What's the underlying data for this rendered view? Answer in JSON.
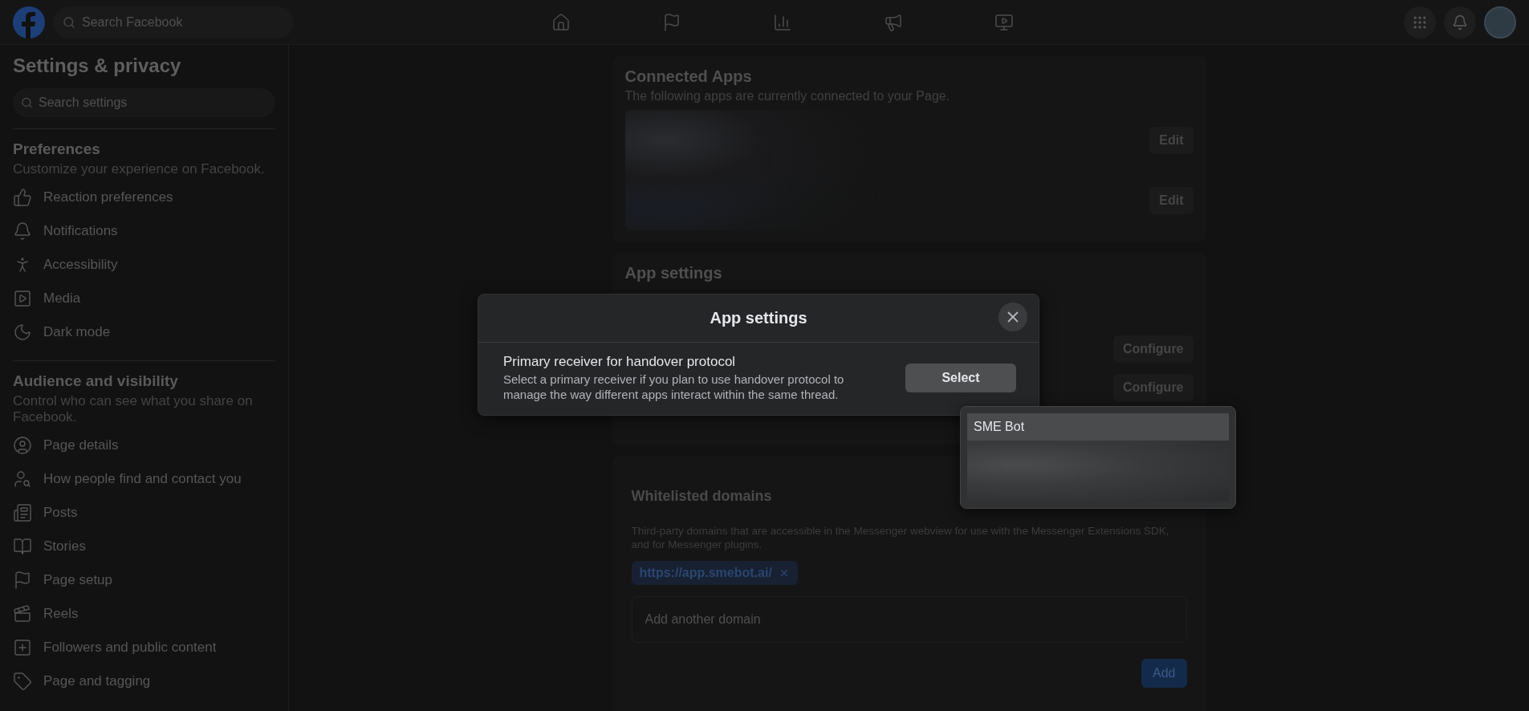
{
  "top_bar": {
    "search": {
      "placeholder": "Search Facebook"
    }
  },
  "sidebar": {
    "title": "Settings & privacy",
    "search": {
      "placeholder": "Search settings"
    },
    "sections": [
      {
        "heading": "Preferences",
        "description": "Customize your experience on Facebook.",
        "items": [
          {
            "label": "Reaction preferences"
          },
          {
            "label": "Notifications"
          },
          {
            "label": "Accessibility"
          },
          {
            "label": "Media"
          },
          {
            "label": "Dark mode"
          }
        ]
      },
      {
        "heading": "Audience and visibility",
        "description": "Control who can see what you share on Facebook.",
        "items": [
          {
            "label": "Page details"
          },
          {
            "label": "How people find and contact you"
          },
          {
            "label": "Posts"
          },
          {
            "label": "Stories"
          },
          {
            "label": "Page setup"
          },
          {
            "label": "Reels"
          },
          {
            "label": "Followers and public content"
          },
          {
            "label": "Page and tagging"
          }
        ]
      }
    ]
  },
  "connected_apps": {
    "title": "Connected Apps",
    "description": "The following apps are currently connected to your Page.",
    "rows": [
      {
        "button": "Edit"
      },
      {
        "button": "Edit"
      }
    ]
  },
  "app_settings": {
    "title": "App settings",
    "rows": [
      {
        "button": "Configure"
      },
      {
        "button": "Configure"
      }
    ]
  },
  "whitelisted_domains": {
    "title": "Whitelisted domains",
    "description": "Third-party domains that are accessible in the Messenger webview for use with the Messenger Extensions SDK, and for Messenger plugins.",
    "domains": [
      {
        "label": "https://app.smebot.ai/"
      }
    ],
    "input": {
      "placeholder": "Add another domain"
    },
    "button": "Add"
  },
  "modal": {
    "title": "App settings",
    "setting": {
      "title": "Primary receiver for handover protocol",
      "description": "Select a primary receiver if you plan to use handover protocol to manage the way different apps interact within the same thread.",
      "button": "Select"
    }
  },
  "dropdown": {
    "options": [
      {
        "label": "SME Bot",
        "selected": true
      }
    ]
  }
}
